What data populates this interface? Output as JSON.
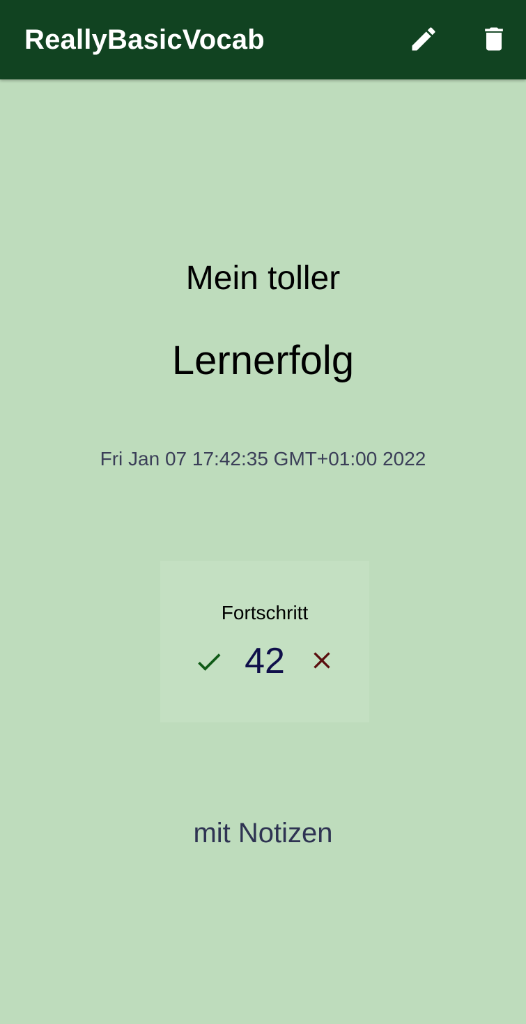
{
  "appbar": {
    "title": "ReallyBasicVocab",
    "background": "#114321",
    "actions": [
      {
        "icon": "edit-icon"
      },
      {
        "icon": "delete-icon"
      }
    ]
  },
  "screen": {
    "background": "#bedcbc"
  },
  "entry": {
    "line1": "Mein toller",
    "line2": "Lernerfolg",
    "date": "Fri Jan 07 17:42:35 GMT+01:00 2022",
    "notes": "mit Notizen"
  },
  "progress": {
    "label": "Fortschritt",
    "value": "42",
    "check_icon": "check-icon",
    "check_color": "#0f5a16",
    "cross_icon": "close-icon",
    "cross_color": "#5a0e0e"
  }
}
